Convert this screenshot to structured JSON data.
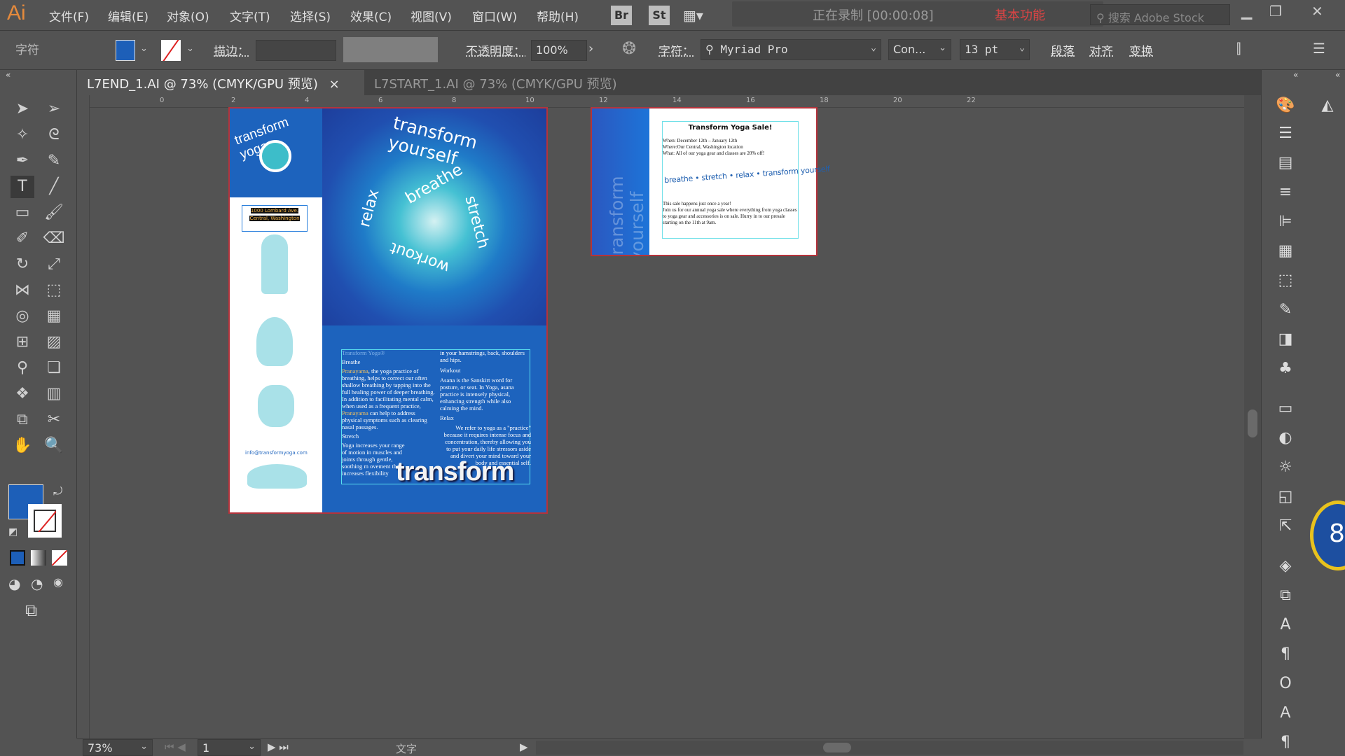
{
  "app": {
    "logo": "Ai",
    "menus": [
      "文件(F)",
      "编辑(E)",
      "对象(O)",
      "文字(T)",
      "选择(S)",
      "效果(C)",
      "视图(V)",
      "窗口(W)",
      "帮助(H)"
    ],
    "bridge": "Br",
    "stock": "St",
    "recording": "正在录制 [00:00:08]",
    "workspace": "基本功能",
    "search_placeholder": "搜索 Adobe Stock"
  },
  "control": {
    "panel_label": "字符",
    "fill_color": "#1d5fb8",
    "stroke_label": "描边：",
    "opacity_label": "不透明度：",
    "opacity": "100%",
    "char_label": "字符：",
    "font": "Myriad Pro",
    "style": "Con...",
    "size": "13 pt",
    "paragraph": "段落",
    "align": "对齐",
    "transform": "变换"
  },
  "tabs": [
    {
      "label": "L7END_1.AI @ 73% (CMYK/GPU 预览)",
      "active": true
    },
    {
      "label": "L7START_1.AI @ 73% (CMYK/GPU 预览)",
      "active": false
    }
  ],
  "ruler": [
    "0",
    "2",
    "4",
    "6",
    "8",
    "10",
    "12",
    "14",
    "16",
    "18",
    "20",
    "22"
  ],
  "tools": [
    [
      "selection-tool",
      "➤"
    ],
    [
      "direct-selection-tool",
      "➢"
    ],
    [
      "magic-wand-tool",
      "✧"
    ],
    [
      "lasso-tool",
      "ᘓ"
    ],
    [
      "pen-tool",
      "✒"
    ],
    [
      "curvature-tool",
      "✎"
    ],
    [
      "type-tool",
      "T"
    ],
    [
      "line-tool",
      "╱"
    ],
    [
      "rectangle-tool",
      "▭"
    ],
    [
      "paintbrush-tool",
      "🖌"
    ],
    [
      "shaper-tool",
      "✐"
    ],
    [
      "eraser-tool",
      "⌫"
    ],
    [
      "rotate-tool",
      "↻"
    ],
    [
      "scale-tool",
      "⤢"
    ],
    [
      "width-tool",
      "⋈"
    ],
    [
      "free-transform-tool",
      "⬚"
    ],
    [
      "shape-builder-tool",
      "◎"
    ],
    [
      "perspective-grid-tool",
      "▦"
    ],
    [
      "mesh-tool",
      "⊞"
    ],
    [
      "gradient-tool",
      "▨"
    ],
    [
      "eyedropper-tool",
      "⚲"
    ],
    [
      "blend-tool",
      "❏"
    ],
    [
      "symbol-sprayer-tool",
      "❖"
    ],
    [
      "column-graph-tool",
      "▥"
    ],
    [
      "artboard-tool",
      "⧉"
    ],
    [
      "slice-tool",
      "✂"
    ],
    [
      "hand-tool",
      "✋"
    ],
    [
      "zoom-tool",
      "🔍"
    ]
  ],
  "right_panel": [
    "color-panel-icon",
    "color-guide-icon",
    "properties-icon",
    "libraries-icon",
    "stroke-icon",
    "align-icon",
    "swatches-icon",
    "transform-icon",
    "brushes-icon",
    "pathfinder-icon",
    "symbols-icon",
    "gradient-icon",
    "transparency-icon",
    "appearance-icon",
    "graphic-styles-icon",
    "export-icon",
    "layers-icon",
    "artboards-icon",
    "character-icon",
    "paragraph-icon",
    "opentype-icon",
    "character-styles-icon",
    "paragraph-styles-icon"
  ],
  "status": {
    "zoom": "73%",
    "page": "1",
    "tool": "文字"
  },
  "badge": "8",
  "artboard1": {
    "logo": "transform yoga",
    "address1": "1000 Lombard Ave.",
    "address2": "Central, Washington",
    "email": "info@transformyoga.com",
    "circle_words": [
      "transform yourself",
      "breathe",
      "stretch",
      "workout",
      "relax"
    ],
    "col1": {
      "heading": "Transform Yoga®",
      "breathe": "Breathe",
      "breathe_pre": "Pranayama",
      "breathe_text1": ", the yoga practice of breathing, helps to correct our often shallow breathing by tapping into the full healing power of deeper breathing. In addition to facilitating mental calm, when used as a frequent practice, ",
      "breathe_pre2": "Pranayama",
      "breathe_text2": " can help to address physical symptoms such as clearing nasal passages.",
      "stretch": "Stretch",
      "stretch_text": "Yoga increases your range of motion in muscles and joints through gentle, soothing m ovement that increases flexibility"
    },
    "col2": {
      "intro": "in your hamstrings, back, shoulders and hips.",
      "workout": "Workout",
      "workout_text": "Asana is the Sanskirt word for posture, or seat. In Yoga, asana practice is intensely physical, enhancing strength while also calming the mind.",
      "relax": "Relax",
      "relax_text": "We refer to yoga as a \"practice\" because it requires intense focus and concentration, thereby allowing you to put your daily life stressors aside and divert your mind toward your body and essential self."
    },
    "transform_word": "transform"
  },
  "artboard2": {
    "side": "transform yourself",
    "title": "Transform Yoga Sale!",
    "when": "When: December 12th – January 12th",
    "where": "Where:Our Central, Washington location",
    "what": "What: All of our yoga gear and classes are 20% off!",
    "curve": "breathe • stretch • relax • transform yourself",
    "once": "This sale happens just once a year!",
    "body": "Join us for our annual yoga sale where everything from yoga classes to yoga gear and accessories is on sale. Hurry in to our presale starting on the 11th at 9am."
  }
}
